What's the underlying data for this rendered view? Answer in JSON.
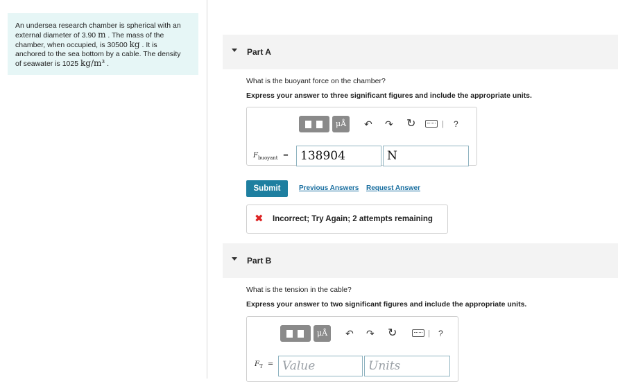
{
  "problem": {
    "line1": "An undersea research chamber is spherical with an",
    "line2_pre": "external diameter of 3.90",
    "line2_unit": "m",
    "line2_post": ". The mass of the",
    "line3_pre": "chamber, when occupied, is 30500",
    "line3_unit": "kg",
    "line3_post": ". It is",
    "line4": "anchored to the sea bottom by a cable. The density",
    "line5_pre": "of seawater is 1025",
    "line5_unit": "kg/m³",
    "line5_post": "."
  },
  "partA": {
    "title": "Part A",
    "question": "What is the buoyant force on the chamber?",
    "instruction": "Express your answer to three significant figures and include the appropriate units.",
    "label_main": "F",
    "label_sub": "buoyant",
    "equals": "=",
    "value": "138904",
    "units": "N",
    "submit": "Submit",
    "prev_answers": "Previous Answers",
    "request_answer": "Request Answer",
    "feedback_icon": "✖",
    "feedback": "Incorrect; Try Again; 2 attempts remaining"
  },
  "partB": {
    "title": "Part B",
    "question": "What is the tension in the cable?",
    "instruction": "Express your answer to two significant figures and include the appropriate units.",
    "label_main": "F",
    "label_sub": "T",
    "equals": "=",
    "value_placeholder": "Value",
    "units_placeholder": "Units"
  },
  "toolbar": {
    "mu_label": "μÅ",
    "undo": "↶",
    "redo": "↷",
    "reset": "↻",
    "help": "?",
    "sep": "|"
  }
}
